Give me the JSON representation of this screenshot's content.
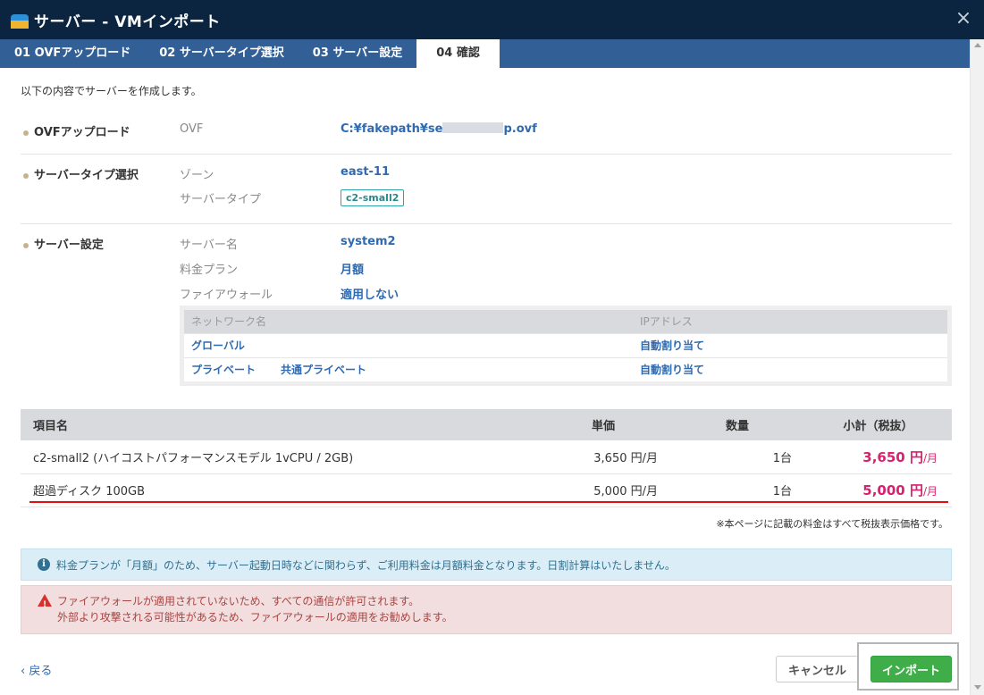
{
  "window": {
    "title": "サーバー - VMインポート",
    "close_icon": "×"
  },
  "tabs": [
    {
      "label": "01 OVFアップロード",
      "active": false
    },
    {
      "label": "02 サーバータイプ選択",
      "active": false
    },
    {
      "label": "03 サーバー設定",
      "active": false
    },
    {
      "label": "04 確認",
      "active": true
    }
  ],
  "intro": "以下の内容でサーバーを作成します。",
  "ovf_section": {
    "label": "OVFアップロード",
    "key": "OVF",
    "value_prefix": "C:¥fakepath¥se",
    "value_suffix": "p.ovf"
  },
  "servertype_section": {
    "label": "サーバータイプ選択",
    "zone_key": "ゾーン",
    "zone_value": "east-11",
    "type_key": "サーバータイプ",
    "type_value": "c2-small2"
  },
  "settings_section": {
    "label": "サーバー設定",
    "name_key": "サーバー名",
    "name_value": "system2",
    "plan_key": "料金プラン",
    "plan_value": "月額",
    "firewall_key": "ファイアウォール",
    "firewall_value": "適用しない"
  },
  "network": {
    "headers": {
      "name": "ネットワーク名",
      "ip": "IPアドレス"
    },
    "rows": [
      {
        "name": "グローバル",
        "name2": "",
        "ip": "自動割り当て"
      },
      {
        "name": "プライベート",
        "name2": "共通プライベート",
        "ip": "自動割り当て"
      }
    ]
  },
  "price_table": {
    "headers": {
      "name": "項目名",
      "unit": "単価",
      "qty": "数量",
      "subtotal": "小計（税抜）"
    },
    "rows": [
      {
        "name": "c2-small2 (ハイコストパフォーマンスモデル 1vCPU / 2GB)",
        "unit": "3,650 円/月",
        "qty": "1台",
        "amount": "3,650 円",
        "per": "/月"
      },
      {
        "name": "超過ディスク 100GB",
        "unit": "5,000 円/月",
        "qty": "1台",
        "amount": "5,000 円",
        "per": "/月"
      }
    ],
    "tax_note": "※本ページに記載の料金はすべて税抜表示価格です。"
  },
  "alerts": {
    "info": "料金プランが「月額」のため、サーバー起動日時などに関わらず、ご利用料金は月額料金となります。日割計算はいたしません。",
    "warn_line1": "ファイアウォールが適用されていないため、すべての通信が許可されます。",
    "warn_line2": "外部より攻撃される可能性があるため、ファイアウォールの適用をお勧めします。"
  },
  "footer": {
    "back": "‹ 戻る",
    "cancel": "キャンセル",
    "import": "インポート"
  },
  "colors": {
    "titlebar": "#0b2540",
    "tabbar": "#315f96",
    "link": "#2f6ab0",
    "price": "#d6226f",
    "import_button": "#3fae49",
    "highlight_line": "#e01010"
  }
}
